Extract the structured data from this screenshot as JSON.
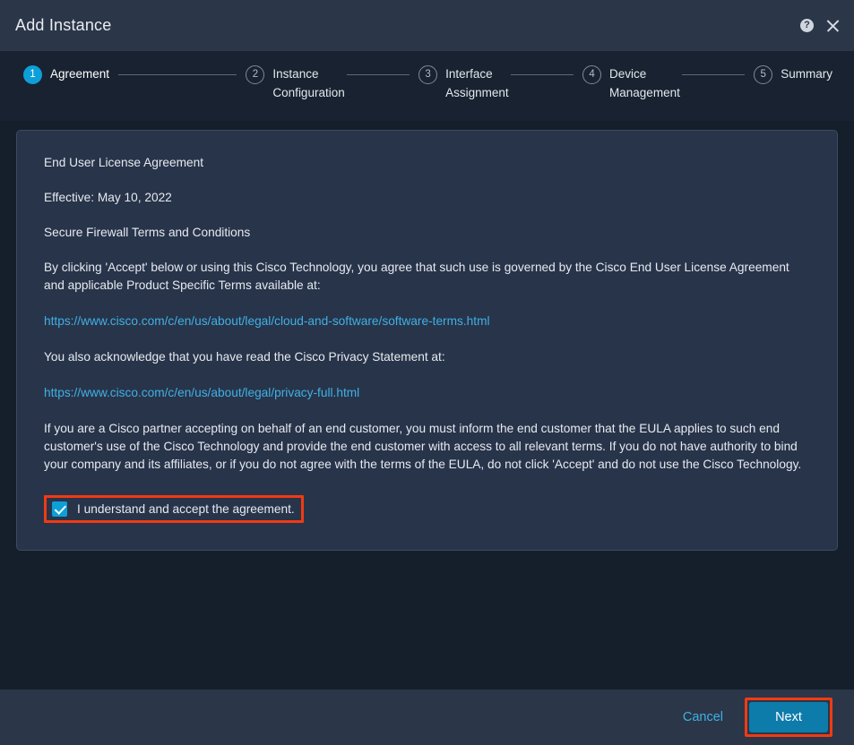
{
  "header": {
    "title": "Add Instance",
    "help_icon": "help-circle-icon",
    "close_icon": "close-icon"
  },
  "stepper": {
    "steps": [
      {
        "number": "1",
        "label": "Agreement",
        "state": "active"
      },
      {
        "number": "2",
        "label": "Instance\nConfiguration",
        "state": "inactive"
      },
      {
        "number": "3",
        "label": "Interface\nAssignment",
        "state": "inactive"
      },
      {
        "number": "4",
        "label": "Device\nManagement",
        "state": "inactive"
      },
      {
        "number": "5",
        "label": "Summary",
        "state": "inactive"
      }
    ]
  },
  "eula": {
    "heading": "End User License Agreement",
    "effective": "Effective: May 10, 2022",
    "terms_title": "Secure Firewall Terms and Conditions",
    "paragraph_1": "By clicking 'Accept' below or using this Cisco Technology, you agree that such use is governed by the Cisco End User License Agreement and applicable Product Specific Terms available at:",
    "link_1": "https://www.cisco.com/c/en/us/about/legal/cloud-and-software/software-terms.html",
    "paragraph_2": "You also acknowledge that you have read the Cisco Privacy Statement at:",
    "link_2": "https://www.cisco.com/c/en/us/about/legal/privacy-full.html",
    "paragraph_3": "If you are a Cisco partner accepting on behalf of an end customer, you must inform the end customer that the EULA applies to such end customer's use of the Cisco Technology and provide the end customer with access to all relevant terms. If you do not have authority to bind your company and its affiliates, or if you do not agree with the terms of the EULA, do not click 'Accept' and do not use the Cisco Technology.",
    "accept_label": "I understand and accept the agreement.",
    "accept_checked": true
  },
  "footer": {
    "cancel_label": "Cancel",
    "next_label": "Next"
  },
  "colors": {
    "accent_blue": "#0d9fd8",
    "link_blue": "#3fb1e5",
    "button_blue": "#0d7cab",
    "highlight_red": "#f23a13",
    "header_bg": "#2b3648",
    "stepper_bg": "#182230",
    "body_bg": "#151f2b",
    "card_bg": "#28344a"
  }
}
